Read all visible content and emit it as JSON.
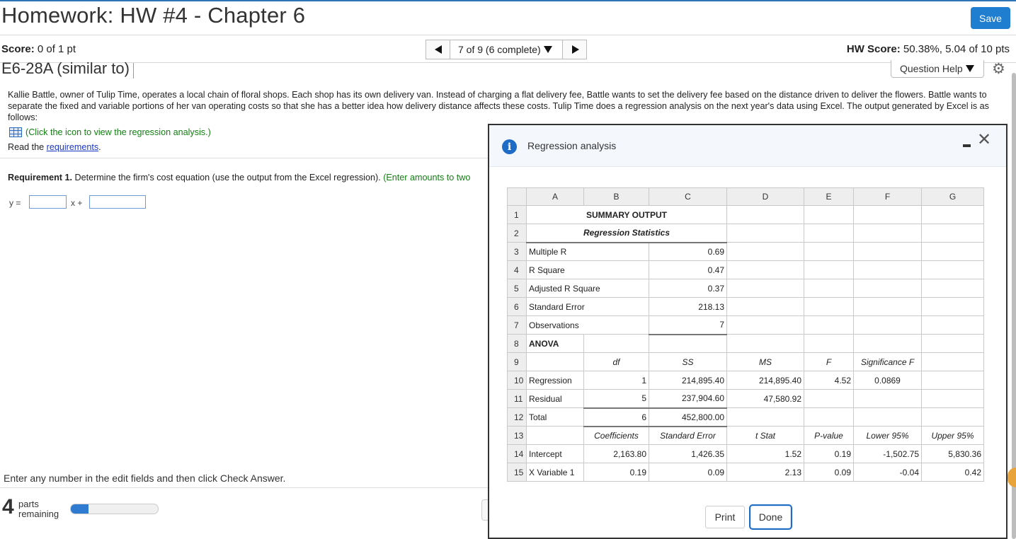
{
  "header": {
    "title": "Homework: HW #4 - Chapter 6",
    "save_label": "Save"
  },
  "status": {
    "score_label": "Score:",
    "score_value": "0 of 1 pt",
    "nav_position": "7 of 9 (6 complete)",
    "hw_score_label": "HW Score:",
    "hw_score_value": "50.38%, 5.04 of 10 pts"
  },
  "question": {
    "title": "E6-28A (similar to)",
    "help_label": "Question Help",
    "text": "Kallie Battle, owner of Tulip Time, operates a local chain of floral shops. Each shop has its own delivery van. Instead of charging a flat delivery fee, Battle wants to set the delivery fee based on the distance driven to deliver the flowers. Battle wants to separate the fixed and variable portions of her van operating costs so that she has a better idea how delivery distance affects these costs. Tulip Time does a regression analysis on the next year's data using Excel. The output generated by Excel is as follows:",
    "click_icon_text": "(Click the icon to view the regression analysis.)",
    "read_prefix": "Read the ",
    "read_link": "requirements",
    "read_suffix": ".",
    "req1_bold": "Requirement 1.",
    "req1_text": " Determine the firm's cost equation (use the output from the Excel regression). ",
    "req1_hint": "(Enter amounts to two",
    "y_label": "y =",
    "x_label": "x +",
    "footer_instruction": "Enter any number in the edit fields and then click Check Answer.",
    "parts_count": "4",
    "parts_label_1": "parts",
    "parts_label_2": "remaining",
    "progress_fraction": 0.2
  },
  "modal": {
    "title": "Regression analysis",
    "print_label": "Print",
    "done_label": "Done",
    "columns": [
      "A",
      "B",
      "C",
      "D",
      "E",
      "F",
      "G"
    ],
    "rows": [
      [
        "1",
        "SUMMARY OUTPUT"
      ],
      [
        "2",
        "Regression Statistics"
      ],
      [
        "3",
        "Multiple R",
        "0.69"
      ],
      [
        "4",
        "R Square",
        "0.47"
      ],
      [
        "5",
        "Adjusted R Square",
        "0.37"
      ],
      [
        "6",
        "Standard Error",
        "218.13"
      ],
      [
        "7",
        "Observations",
        "7"
      ],
      [
        "8",
        "ANOVA"
      ],
      [
        "9",
        "",
        "df",
        "SS",
        "MS",
        "F",
        "Significance F",
        ""
      ],
      [
        "10",
        "Regression",
        "1",
        "214,895.40",
        "214,895.40",
        "4.52",
        "0.0869",
        ""
      ],
      [
        "11",
        "Residual",
        "5",
        "237,904.60",
        "47,580.92",
        "",
        "",
        ""
      ],
      [
        "12",
        "Total",
        "6",
        "452,800.00",
        "",
        "",
        "",
        ""
      ],
      [
        "13",
        "",
        "Coefficients",
        "Standard Error",
        "t Stat",
        "P-value",
        "Lower 95%",
        "Upper 95%"
      ],
      [
        "14",
        "Intercept",
        "2,163.80",
        "1,426.35",
        "1.52",
        "0.19",
        "-1,502.75",
        "5,830.36"
      ],
      [
        "15",
        "X Variable 1",
        "0.19",
        "0.09",
        "2.13",
        "0.09",
        "-0.04",
        "0.42"
      ]
    ]
  }
}
